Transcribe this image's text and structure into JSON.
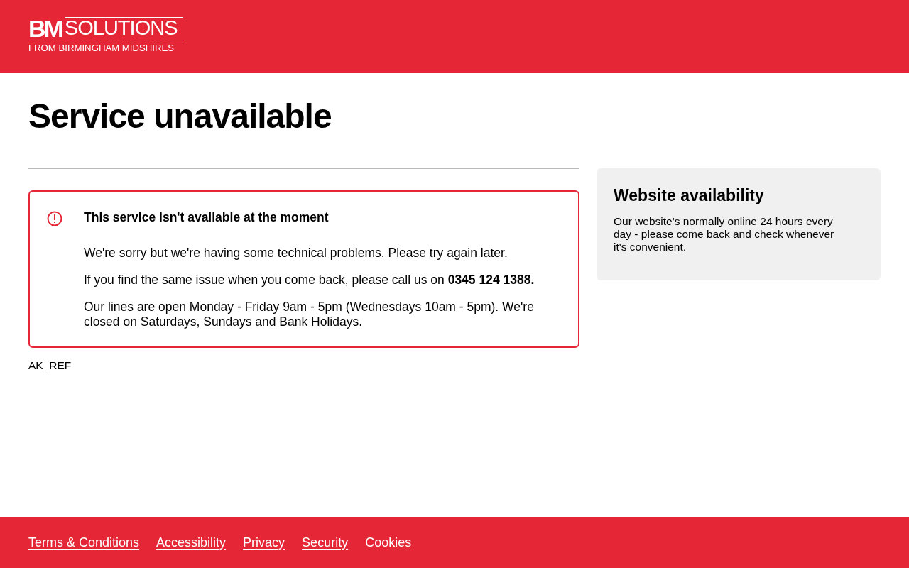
{
  "header": {
    "logo": {
      "mark": "BM",
      "name": "SOLUTIONS",
      "tagline": "FROM BIRMINGHAM MIDSHIRES"
    }
  },
  "title": "Service unavailable",
  "alert": {
    "heading": "This service isn't available at the moment",
    "paragraphs": [
      "We're sorry but we're having some technical problems. Please try again later.",
      "If you find the same issue when you come back, please call us on **0345 124 1388.**",
      "Our lines are open Monday - Friday 9am - 5pm (Wednesdays 10am - 5pm). We're closed on Saturdays, Sundays and Bank Holidays."
    ]
  },
  "reference": "AK_REF",
  "sidebar": {
    "title": "Website availability",
    "text": "Our website's normally online 24 hours every day - please come back and check whenever it's convenient."
  },
  "footer": {
    "links": [
      {
        "label": "Terms & Conditions",
        "underlined": true
      },
      {
        "label": "Accessibility",
        "underlined": true
      },
      {
        "label": "Privacy",
        "underlined": true
      },
      {
        "label": "Security",
        "underlined": true
      },
      {
        "label": "Cookies",
        "underlined": false
      }
    ]
  }
}
